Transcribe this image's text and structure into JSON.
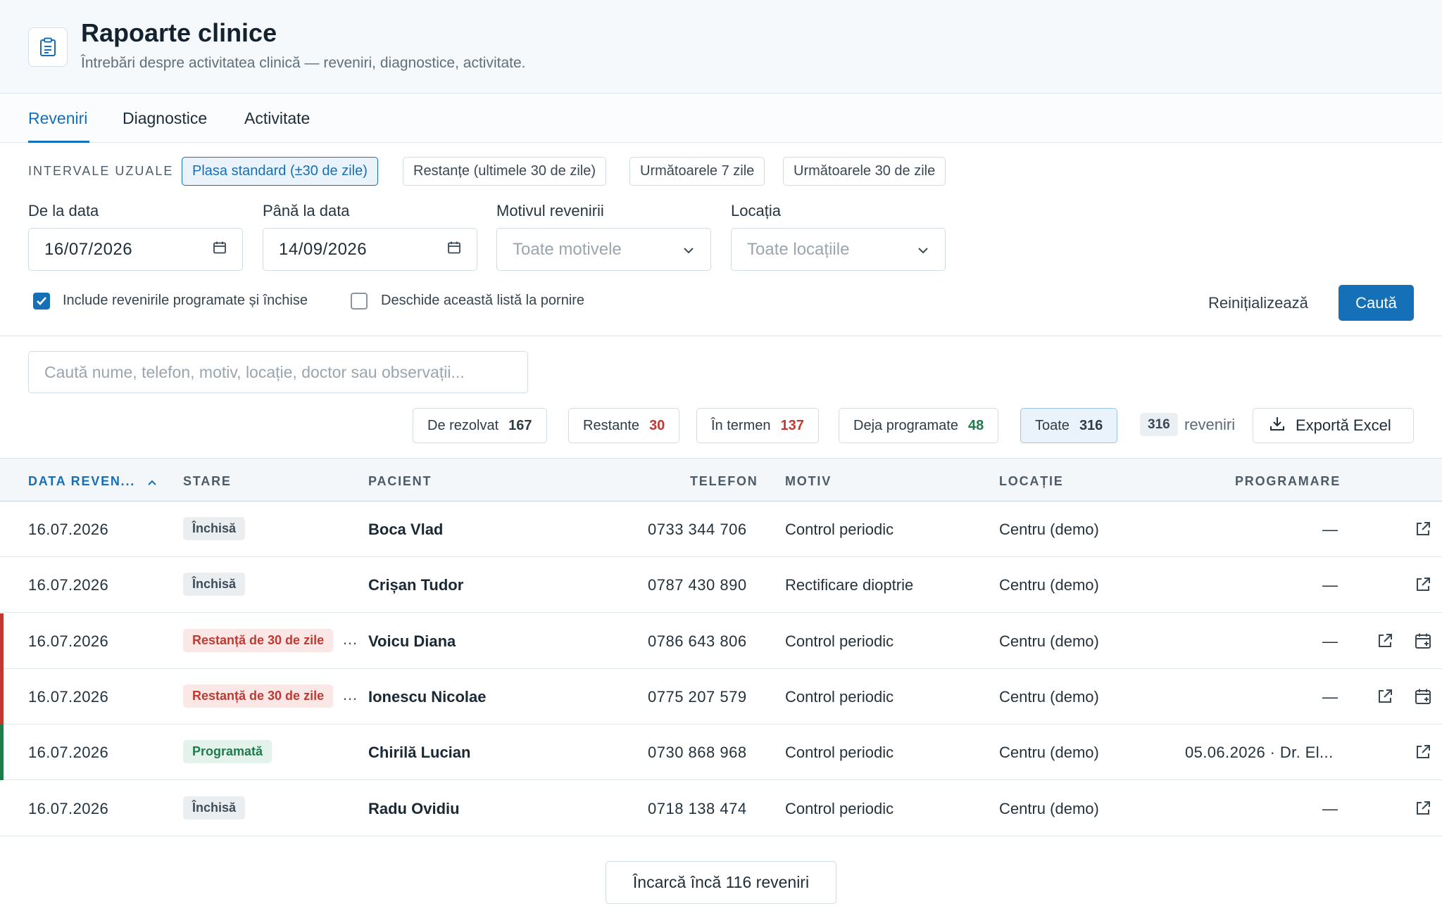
{
  "header": {
    "title": "Rapoarte clinice",
    "subtitle": "Întrebări despre activitatea clinică — reveniri, diagnostice, activitate.",
    "icon": "clipboard-icon"
  },
  "tabs": [
    {
      "label": "Reveniri",
      "active": true
    },
    {
      "label": "Diagnostice",
      "active": false
    },
    {
      "label": "Activitate",
      "active": false
    }
  ],
  "presets": {
    "label": "INTERVALE UZUALE",
    "items": [
      {
        "label": "Plasa standard (±30 de zile)",
        "active": true
      },
      {
        "label": "Restanțe (ultimele 30 de zile)",
        "active": false
      },
      {
        "label": "Următoarele 7 zile",
        "active": false
      },
      {
        "label": "Următoarele 30 de zile",
        "active": false
      }
    ]
  },
  "filters": {
    "from_label": "De la data",
    "from_value": "16/07/2026",
    "to_label": "Până la data",
    "to_value": "14/09/2026",
    "reason_label": "Motivul revenirii",
    "reason_placeholder": "Toate motivele",
    "location_label": "Locația",
    "location_placeholder": "Toate locațiile",
    "include_closed_label": "Include revenirile programate și închise",
    "include_closed_checked": true,
    "open_on_start_label": "Deschide această listă la pornire",
    "open_on_start_checked": false,
    "reset_label": "Reinițializează",
    "search_label": "Caută"
  },
  "search": {
    "placeholder": "Caută nume, telefon, motiv, locație, doctor sau observații..."
  },
  "stats": [
    {
      "label": "De rezolvat",
      "value": "167",
      "color": "#2e3c47",
      "active": false
    },
    {
      "label": "Restante",
      "value": "30",
      "color": "#c13a32",
      "active": false
    },
    {
      "label": "În termen",
      "value": "137",
      "color": "#c13a32",
      "active": false
    },
    {
      "label": "Deja programate",
      "value": "48",
      "color": "#1f7a4c",
      "active": false
    },
    {
      "label": "Toate",
      "value": "316",
      "color": "#2e3c47",
      "active": true
    }
  ],
  "result_count": "316",
  "result_label": "reveniri",
  "export_label": "Exportă Excel",
  "table": {
    "columns": [
      "DATA REVEN...",
      "STARE",
      "PACIENT",
      "TELEFON",
      "MOTIV",
      "LOCAȚIE",
      "PROGRAMARE"
    ],
    "rows": [
      {
        "date": "16.07.2026",
        "status": "Închisă",
        "status_type": "closed",
        "patient": "Boca Vlad",
        "phone": "0733 344 706",
        "reason": "Control periodic",
        "location": "Centru (demo)",
        "appointment": "—",
        "accent": "",
        "actions": [
          "open-external-icon"
        ]
      },
      {
        "date": "16.07.2026",
        "status": "Închisă",
        "status_type": "closed",
        "patient": "Crișan Tudor",
        "phone": "0787 430 890",
        "reason": "Rectificare dioptrie",
        "location": "Centru (demo)",
        "appointment": "—",
        "accent": "",
        "actions": [
          "open-external-icon"
        ]
      },
      {
        "date": "16.07.2026",
        "status": "Restanță de 30 de zile",
        "status_type": "overdue",
        "patient": "Voicu Diana",
        "phone": "0786 643 806",
        "reason": "Control periodic",
        "location": "Centru (demo)",
        "appointment": "—",
        "accent": "#c13a32",
        "actions": [
          "open-external-icon",
          "calendar-add-icon"
        ]
      },
      {
        "date": "16.07.2026",
        "status": "Restanță de 30 de zile",
        "status_type": "overdue",
        "patient": "Ionescu Nicolae",
        "phone": "0775 207 579",
        "reason": "Control periodic",
        "location": "Centru (demo)",
        "appointment": "—",
        "accent": "#c13a32",
        "actions": [
          "open-external-icon",
          "calendar-add-icon"
        ]
      },
      {
        "date": "16.07.2026",
        "status": "Programată",
        "status_type": "scheduled",
        "patient": "Chirilă Lucian",
        "phone": "0730 868 968",
        "reason": "Control periodic",
        "location": "Centru (demo)",
        "appointment": "05.06.2026 · Dr. El...",
        "accent": "#1f7a4c",
        "actions": [
          "open-external-icon"
        ]
      },
      {
        "date": "16.07.2026",
        "status": "Închisă",
        "status_type": "closed",
        "patient": "Radu Ovidiu",
        "phone": "0718 138 474",
        "reason": "Control periodic",
        "location": "Centru (demo)",
        "appointment": "—",
        "accent": "",
        "actions": [
          "open-external-icon"
        ]
      }
    ]
  },
  "load_more_label": "Încarcă încă 116 reveniri",
  "colors": {
    "accent": "#1570b8",
    "danger": "#c13a32",
    "success": "#1f7a4c"
  }
}
